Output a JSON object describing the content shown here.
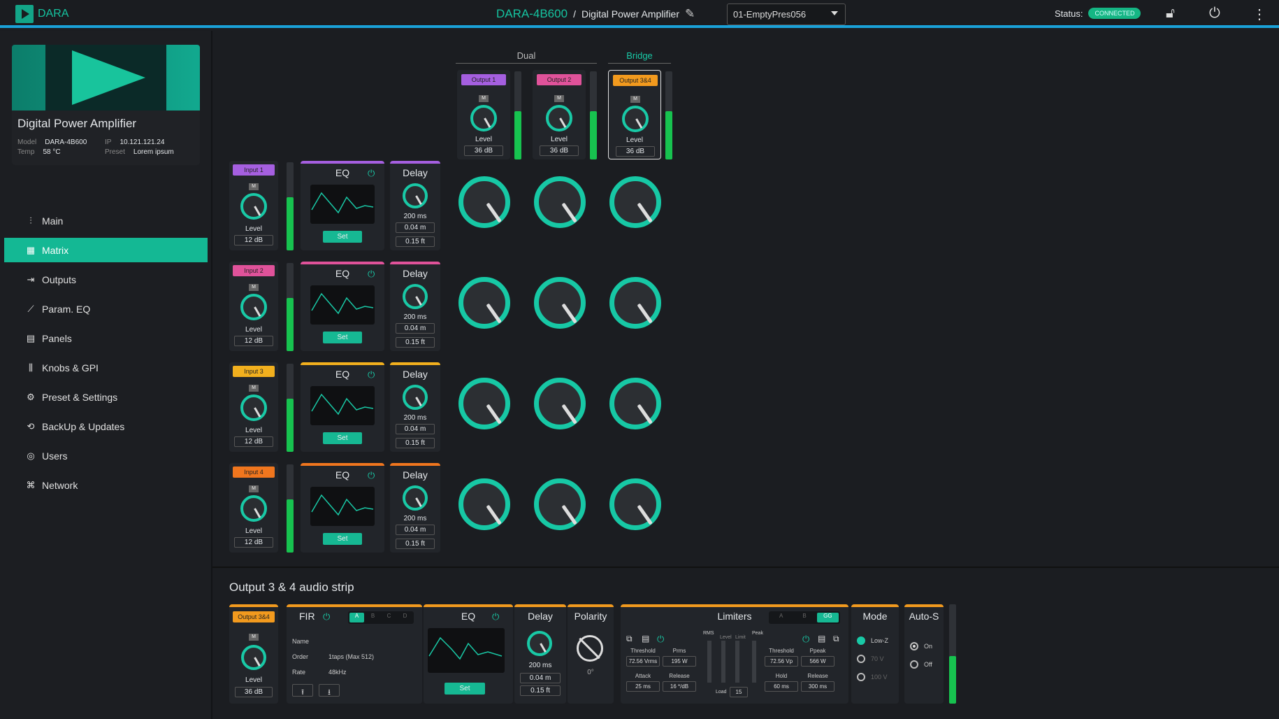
{
  "topbar": {
    "brand": "DARA",
    "device": "DARA-4B600",
    "separator": "/",
    "device_name": "Digital Power Amplifier",
    "preset": "01-EmptyPres056",
    "status_label": "Status:",
    "status_value": "CONNECTED",
    "icons": [
      "pencil-icon",
      "caret-down-icon",
      "lock-icon",
      "power-icon",
      "more-vertical-icon"
    ]
  },
  "device_card": {
    "title": "Digital Power Amplifier",
    "model_key": "Model",
    "model": "DARA-4B600",
    "ip_key": "IP",
    "ip": "10.121.121.24",
    "temp_key": "Temp",
    "temp": "58 °C",
    "preset_key": "Preset",
    "preset": "Lorem ipsum"
  },
  "nav": [
    {
      "label": "Main",
      "icon": "sliders-icon"
    },
    {
      "label": "Matrix",
      "icon": "grid-icon",
      "active": true
    },
    {
      "label": "Outputs",
      "icon": "exit-icon"
    },
    {
      "label": "Param. EQ",
      "icon": "trend-icon"
    },
    {
      "label": "Panels",
      "icon": "panel-icon"
    },
    {
      "label": "Knobs & GPI",
      "icon": "knobs-icon"
    },
    {
      "label": "Preset & Settings",
      "icon": "gear-icon"
    },
    {
      "label": "BackUp & Updates",
      "icon": "sync-icon"
    },
    {
      "label": "Users",
      "icon": "user-icon"
    },
    {
      "label": "Network",
      "icon": "network-icon"
    }
  ],
  "matrix": {
    "group_dual": "Dual",
    "group_bridge": "Bridge",
    "outputs": [
      {
        "label": "Output 1",
        "color": "#a55fe0",
        "mute": "M",
        "level_label": "Level",
        "value": "36 dB",
        "meter": 0.55
      },
      {
        "label": "Output 2",
        "color": "#e0529a",
        "mute": "M",
        "level_label": "Level",
        "value": "36 dB",
        "meter": 0.55
      },
      {
        "label": "Output 3&4",
        "color": "#f29a1e",
        "mute": "M",
        "level_label": "Level",
        "value": "36 dB",
        "meter": 0.55
      }
    ],
    "inputs": [
      {
        "label": "Input 1",
        "color": "#a55fe0",
        "mute": "M",
        "level_label": "Level",
        "value": "12 dB",
        "meter": 0.6,
        "eq": "EQ",
        "set": "Set",
        "delay": "Delay",
        "delay_ms": "200 ms",
        "delay_m": "0.04 m",
        "delay_ft": "0.15 ft"
      },
      {
        "label": "Input 2",
        "color": "#e0529a",
        "mute": "M",
        "level_label": "Level",
        "value": "12 dB",
        "meter": 0.6,
        "eq": "EQ",
        "set": "Set",
        "delay": "Delay",
        "delay_ms": "200 ms",
        "delay_m": "0.04 m",
        "delay_ft": "0.15 ft"
      },
      {
        "label": "Input 3",
        "color": "#f2b01e",
        "mute": "M",
        "level_label": "Level",
        "value": "12 dB",
        "meter": 0.6,
        "eq": "EQ",
        "set": "Set",
        "delay": "Delay",
        "delay_ms": "200 ms",
        "delay_m": "0.04 m",
        "delay_ft": "0.15 ft"
      },
      {
        "label": "Input 4",
        "color": "#f0761e",
        "mute": "M",
        "level_label": "Level",
        "value": "12 dB",
        "meter": 0.6,
        "eq": "EQ",
        "set": "Set",
        "delay": "Delay",
        "delay_ms": "200 ms",
        "delay_m": "0.04 m",
        "delay_ft": "0.15 ft"
      }
    ]
  },
  "strip": {
    "title": "Output 3 & 4 audio strip",
    "output": {
      "label": "Output 3&4",
      "mute": "M",
      "level_label": "Level",
      "value": "36 dB"
    },
    "fir": {
      "title": "FIR",
      "slots": [
        "A",
        "B",
        "C",
        "D"
      ],
      "name_key": "Name",
      "order_key": "Order",
      "order": "1taps (Max 512)",
      "rate_key": "Rate",
      "rate": "48kHz"
    },
    "eq": {
      "title": "EQ",
      "set": "Set"
    },
    "delay": {
      "title": "Delay",
      "ms": "200 ms",
      "m": "0.04 m",
      "ft": "0.15 ft"
    },
    "polarity": {
      "title": "Polarity",
      "value": "0°"
    },
    "limiters": {
      "title": "Limiters",
      "slots": [
        "A",
        "B",
        "GG"
      ],
      "rms": "RMS",
      "peak": "Peak",
      "level": "Level",
      "limit": "Limit",
      "load": "Load",
      "load_val": "15",
      "threshold": "Threshold",
      "threshold_val": "72.56 Vrms",
      "prms": "Prms",
      "prms_val": "195 W",
      "attack": "Attack",
      "attack_val": "25 ms",
      "release": "Release",
      "release_val": "16 */dB",
      "pthreshold_val": "72.56 Vp",
      "ppeak": "Ppeak",
      "ppeak_val": "566 W",
      "hold": "Hold",
      "hold_val": "60 ms",
      "prelease_val": "300 ms"
    },
    "mode": {
      "title": "Mode",
      "options": [
        "Low-Z",
        "70 V",
        "100 V"
      ]
    },
    "autos": {
      "title": "Auto-S",
      "options": [
        "On",
        "Off"
      ]
    }
  }
}
